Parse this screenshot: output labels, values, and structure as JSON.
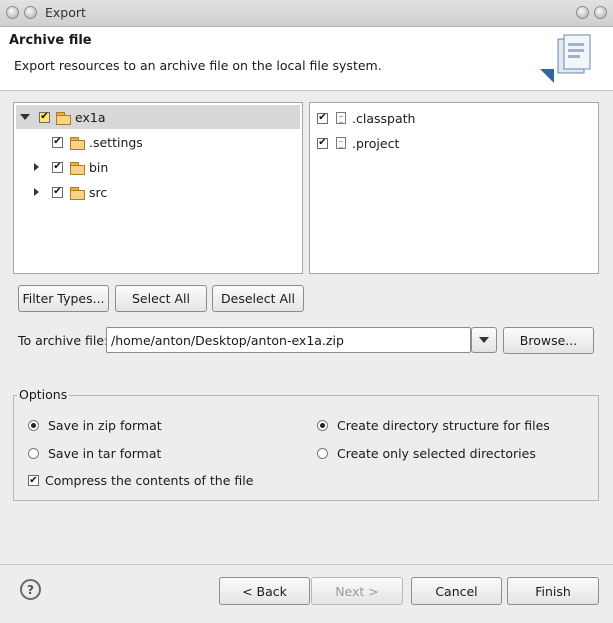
{
  "window": {
    "title": "Export"
  },
  "banner": {
    "title": "Archive file",
    "description": "Export resources to an archive file on the local file system."
  },
  "tree": [
    {
      "label": "ex1a",
      "checked": true,
      "expanded": true,
      "icon": "folder-open-icon"
    },
    {
      "label": ".settings",
      "checked": true,
      "icon": "folder-icon"
    },
    {
      "label": "bin",
      "checked": true,
      "icon": "folder-icon"
    },
    {
      "label": "src",
      "checked": true,
      "icon": "folder-icon"
    }
  ],
  "files": [
    {
      "label": ".classpath",
      "checked": true,
      "icon": "file-icon"
    },
    {
      "label": ".project",
      "checked": true,
      "icon": "file-icon"
    }
  ],
  "selection_buttons": {
    "filter_types": "Filter Types...",
    "select_all": "Select All",
    "deselect_all": "Deselect All"
  },
  "archive": {
    "label": "To archive file:",
    "value": "/home/anton/Desktop/anton-ex1a.zip",
    "browse": "Browse..."
  },
  "options": {
    "title": "Options",
    "zip": "Save in zip format",
    "tar": "Save in tar format",
    "create_structure": "Create directory structure for files",
    "selected_dirs": "Create only selected directories",
    "compress": "Compress the contents of the file",
    "zip_selected": true,
    "structure_selected": true,
    "compress_checked": true
  },
  "footer": {
    "help_icon": "?",
    "back": "< Back",
    "next": "Next >",
    "cancel": "Cancel",
    "finish": "Finish"
  }
}
